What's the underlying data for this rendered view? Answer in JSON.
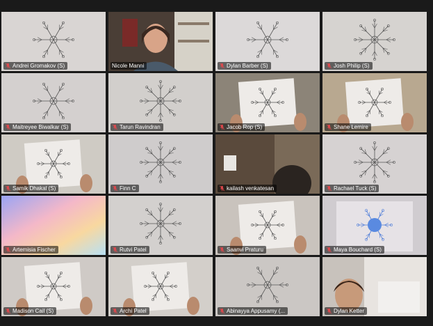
{
  "participants": [
    {
      "name": "Andrei Gromakov (S)",
      "muted": true,
      "bg": "#d9d5d3",
      "scene": "paper"
    },
    {
      "name": "Nicole Manni",
      "muted": false,
      "bg": "#3a3230",
      "scene": "person",
      "active": true
    },
    {
      "name": "Dylan Barber (S)",
      "muted": true,
      "bg": "#dcd9d9",
      "scene": "paper"
    },
    {
      "name": "Josh Philip (S)",
      "muted": true,
      "bg": "#d6d3d0",
      "scene": "paper"
    },
    {
      "name": "Maitreyee Biwalkar (S)",
      "muted": true,
      "bg": "#d4d0cf",
      "scene": "paper"
    },
    {
      "name": "Tarun Ravindran",
      "muted": true,
      "bg": "#d2cfcc",
      "scene": "paper"
    },
    {
      "name": "Jacob Rop (S)",
      "muted": true,
      "bg": "#8c8478",
      "scene": "held"
    },
    {
      "name": "Shane Lemire",
      "muted": true,
      "bg": "#b8a890",
      "scene": "held"
    },
    {
      "name": "Samik Dhakal (S)",
      "muted": true,
      "bg": "#cfcbc4",
      "scene": "held"
    },
    {
      "name": "Finn C",
      "muted": true,
      "bg": "#cfcccc",
      "scene": "paper"
    },
    {
      "name": "kailash venkatesan",
      "muted": true,
      "bg": "#5a4a3c",
      "scene": "dark"
    },
    {
      "name": "Rachael Tuck (S)",
      "muted": true,
      "bg": "#d6d2d2",
      "scene": "paper"
    },
    {
      "name": "Artemisia Fischer",
      "muted": true,
      "bg": "#c8c4f0",
      "scene": "color"
    },
    {
      "name": "Rutvi Patel",
      "muted": true,
      "bg": "#d3d0ce",
      "scene": "paper"
    },
    {
      "name": "Saanvi Praturu",
      "muted": true,
      "bg": "#c9c3bd",
      "scene": "held"
    },
    {
      "name": "Maya Bouchard (S)",
      "muted": true,
      "bg": "#d0ccd0",
      "scene": "blue"
    },
    {
      "name": "Madison Cail (S)",
      "muted": true,
      "bg": "#cfcac6",
      "scene": "held"
    },
    {
      "name": "Archi Patel",
      "muted": true,
      "bg": "#d3cfca",
      "scene": "held"
    },
    {
      "name": "Abinayya Appusamy (...",
      "muted": true,
      "bg": "#cbc7c4",
      "scene": "paper"
    },
    {
      "name": "Dylan Ketter",
      "muted": true,
      "bg": "#c8c2bc",
      "scene": "person2"
    }
  ],
  "colors": {
    "active_border": "#d8e06a",
    "mic_muted": "#e5484d",
    "background": "#1a1a1a"
  }
}
